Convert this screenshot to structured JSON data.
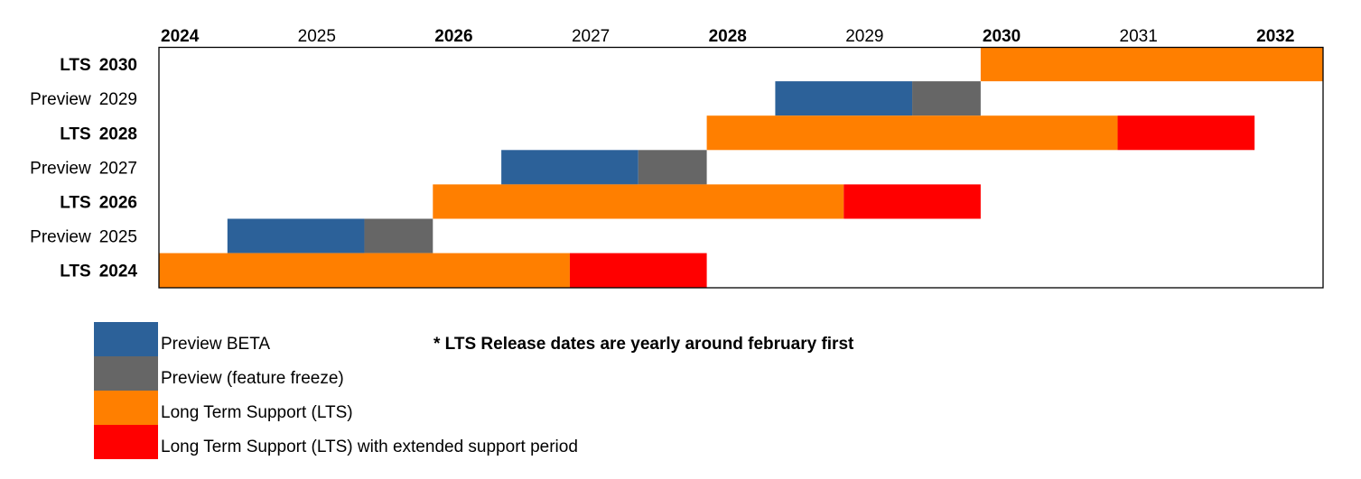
{
  "chart_data": {
    "type": "gantt",
    "title": "",
    "x_axis": {
      "range": [
        2024,
        2032.5
      ],
      "ticks": [
        {
          "label": "2024",
          "value": 2024,
          "bold": true
        },
        {
          "label": "2025",
          "value": 2025,
          "bold": false
        },
        {
          "label": "2026",
          "value": 2026,
          "bold": true
        },
        {
          "label": "2027",
          "value": 2027,
          "bold": false
        },
        {
          "label": "2028",
          "value": 2028,
          "bold": true
        },
        {
          "label": "2029",
          "value": 2029,
          "bold": false
        },
        {
          "label": "2030",
          "value": 2030,
          "bold": true
        },
        {
          "label": "2031",
          "value": 2031,
          "bold": false
        },
        {
          "label": "2032",
          "value": 2032,
          "bold": true
        }
      ],
      "position": "top",
      "grid": false
    },
    "rows": [
      {
        "kind": "LTS",
        "year": "2030",
        "bold": true,
        "segments": [
          {
            "phase": "lts",
            "start": 2030.0,
            "end": 2032.5
          }
        ]
      },
      {
        "kind": "Preview",
        "year": "2029",
        "bold": false,
        "segments": [
          {
            "phase": "beta",
            "start": 2028.5,
            "end": 2029.5
          },
          {
            "phase": "freeze",
            "start": 2029.5,
            "end": 2030.0
          }
        ]
      },
      {
        "kind": "LTS",
        "year": "2028",
        "bold": true,
        "segments": [
          {
            "phase": "lts",
            "start": 2028.0,
            "end": 2031.0
          },
          {
            "phase": "extended",
            "start": 2031.0,
            "end": 2032.0
          }
        ]
      },
      {
        "kind": "Preview",
        "year": "2027",
        "bold": false,
        "segments": [
          {
            "phase": "beta",
            "start": 2026.5,
            "end": 2027.5
          },
          {
            "phase": "freeze",
            "start": 2027.5,
            "end": 2028.0
          }
        ]
      },
      {
        "kind": "LTS",
        "year": "2026",
        "bold": true,
        "segments": [
          {
            "phase": "lts",
            "start": 2026.0,
            "end": 2029.0
          },
          {
            "phase": "extended",
            "start": 2029.0,
            "end": 2030.0
          }
        ]
      },
      {
        "kind": "Preview",
        "year": "2025",
        "bold": false,
        "segments": [
          {
            "phase": "beta",
            "start": 2024.5,
            "end": 2025.5
          },
          {
            "phase": "freeze",
            "start": 2025.5,
            "end": 2026.0
          }
        ]
      },
      {
        "kind": "LTS",
        "year": "2024",
        "bold": true,
        "segments": [
          {
            "phase": "lts",
            "start": 2024.0,
            "end": 2027.0
          },
          {
            "phase": "extended",
            "start": 2027.0,
            "end": 2028.0
          }
        ]
      }
    ],
    "phases": {
      "beta": {
        "label": "Preview BETA",
        "color": "#2c6199"
      },
      "freeze": {
        "label": "Preview (feature freeze)",
        "color": "#666666"
      },
      "lts": {
        "label": "Long Term Support (LTS)",
        "color": "#ff7f00"
      },
      "extended": {
        "label": "Long Term Support (LTS) with extended support period",
        "color": "#ff0000"
      }
    },
    "legend": {
      "placement": "bottom-left",
      "order": [
        "beta",
        "freeze",
        "lts",
        "extended"
      ]
    },
    "annotations": [
      "* LTS Release dates are yearly around february first"
    ]
  },
  "legend_items": [
    {
      "label": "Preview BETA",
      "color": "#2c6199"
    },
    {
      "label": "Preview (feature freeze)",
      "color": "#666666"
    },
    {
      "label": "Long Term Support (LTS)",
      "color": "#ff7f00"
    },
    {
      "label": "Long Term Support (LTS) with extended support period",
      "color": "#ff0000"
    }
  ],
  "note": "* LTS Release dates are yearly around february first"
}
